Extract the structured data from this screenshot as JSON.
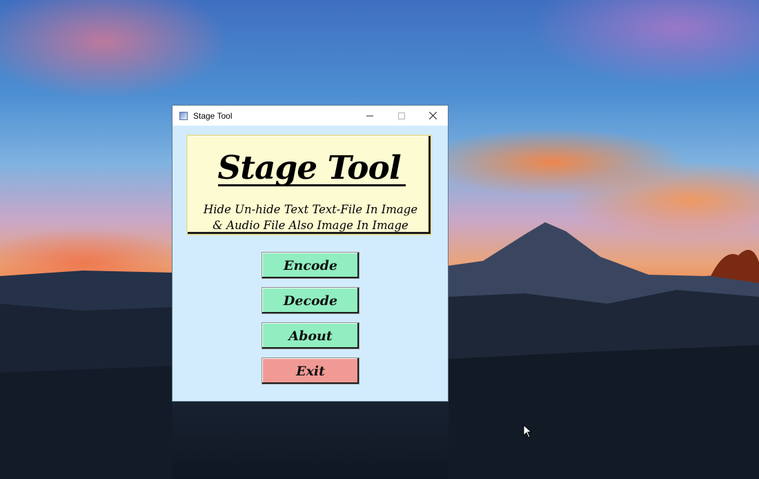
{
  "window": {
    "title": "Stage Tool",
    "controls": {
      "minimize": "minimize-icon",
      "maximize": "maximize-icon",
      "close": "close-icon"
    }
  },
  "banner": {
    "title": "Stage Tool",
    "subtitle_line1": "Hide Un-hide Text Text-File In Image",
    "subtitle_line2": "& Audio File Also Image In Image"
  },
  "buttons": {
    "encode": "Encode",
    "decode": "Decode",
    "about": "About",
    "exit": "Exit"
  },
  "colors": {
    "window_bg": "#d2ecfd",
    "banner_bg": "#fcfbd1",
    "action_button": "#90eec0",
    "exit_button": "#f19a95"
  }
}
